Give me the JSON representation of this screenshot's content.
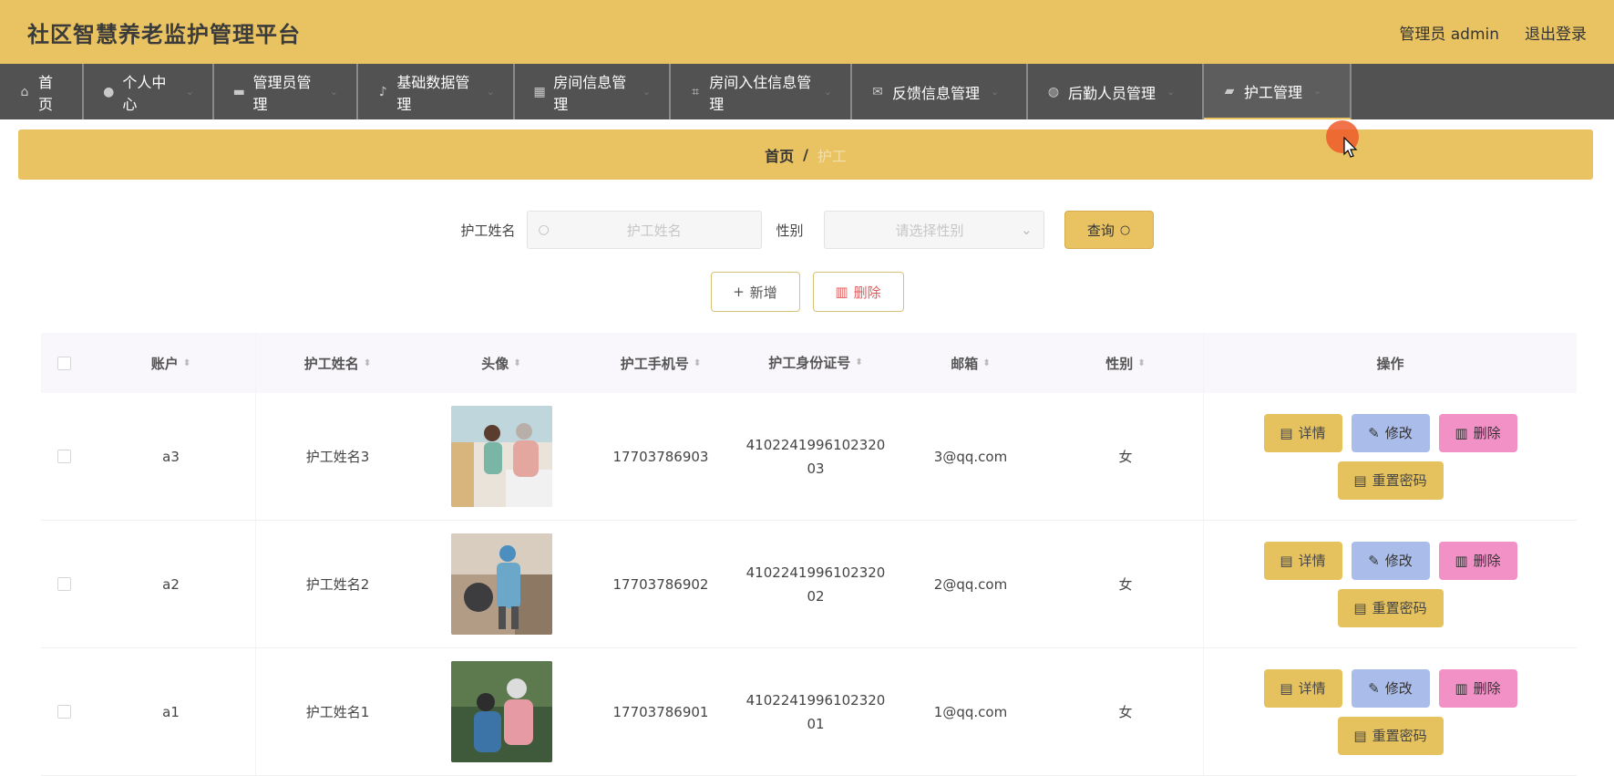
{
  "header": {
    "title": "社区智慧养老监护管理平台",
    "user_label": "管理员 admin",
    "logout_label": "退出登录"
  },
  "nav": [
    {
      "label": "首页",
      "icon": "home-icon"
    },
    {
      "label": "个人中心",
      "icon": "user-icon"
    },
    {
      "label": "管理员管理",
      "icon": "card-icon"
    },
    {
      "label": "基础数据管理",
      "icon": "mic-icon"
    },
    {
      "label": "房间信息管理",
      "icon": "grid-icon"
    },
    {
      "label": "房间入住信息管理",
      "icon": "crop-icon"
    },
    {
      "label": "反馈信息管理",
      "icon": "message-icon"
    },
    {
      "label": "后勤人员管理",
      "icon": "globe-icon"
    },
    {
      "label": "护工管理",
      "icon": "briefcase-icon"
    }
  ],
  "breadcrumb": {
    "home": "首页",
    "separator": "/",
    "current": "护工"
  },
  "search": {
    "name_label": "护工姓名",
    "name_placeholder": "护工姓名",
    "gender_label": "性别",
    "gender_placeholder": "请选择性别",
    "query_label": "查询"
  },
  "actions": {
    "add_label": "新增",
    "delete_label": "删除"
  },
  "table": {
    "headers": [
      "账户",
      "护工姓名",
      "头像",
      "护工手机号",
      "护工身份证号",
      "邮箱",
      "性别",
      "操作"
    ],
    "rows": [
      {
        "account": "a3",
        "name": "护工姓名3",
        "phone": "17703786903",
        "id_card": "410224199610232003",
        "email": "3@qq.com",
        "gender": "女"
      },
      {
        "account": "a2",
        "name": "护工姓名2",
        "phone": "17703786902",
        "id_card": "410224199610232002",
        "email": "2@qq.com",
        "gender": "女"
      },
      {
        "account": "a1",
        "name": "护工姓名1",
        "phone": "17703786901",
        "id_card": "410224199610232001",
        "email": "1@qq.com",
        "gender": "女"
      }
    ],
    "row_actions": {
      "detail": "详情",
      "edit": "修改",
      "delete": "删除",
      "reset": "重置密码"
    }
  },
  "colors": {
    "accent": "#e9c361",
    "nav_bg": "#525252",
    "edit": "#a9bcea",
    "delete": "#f291c6"
  }
}
